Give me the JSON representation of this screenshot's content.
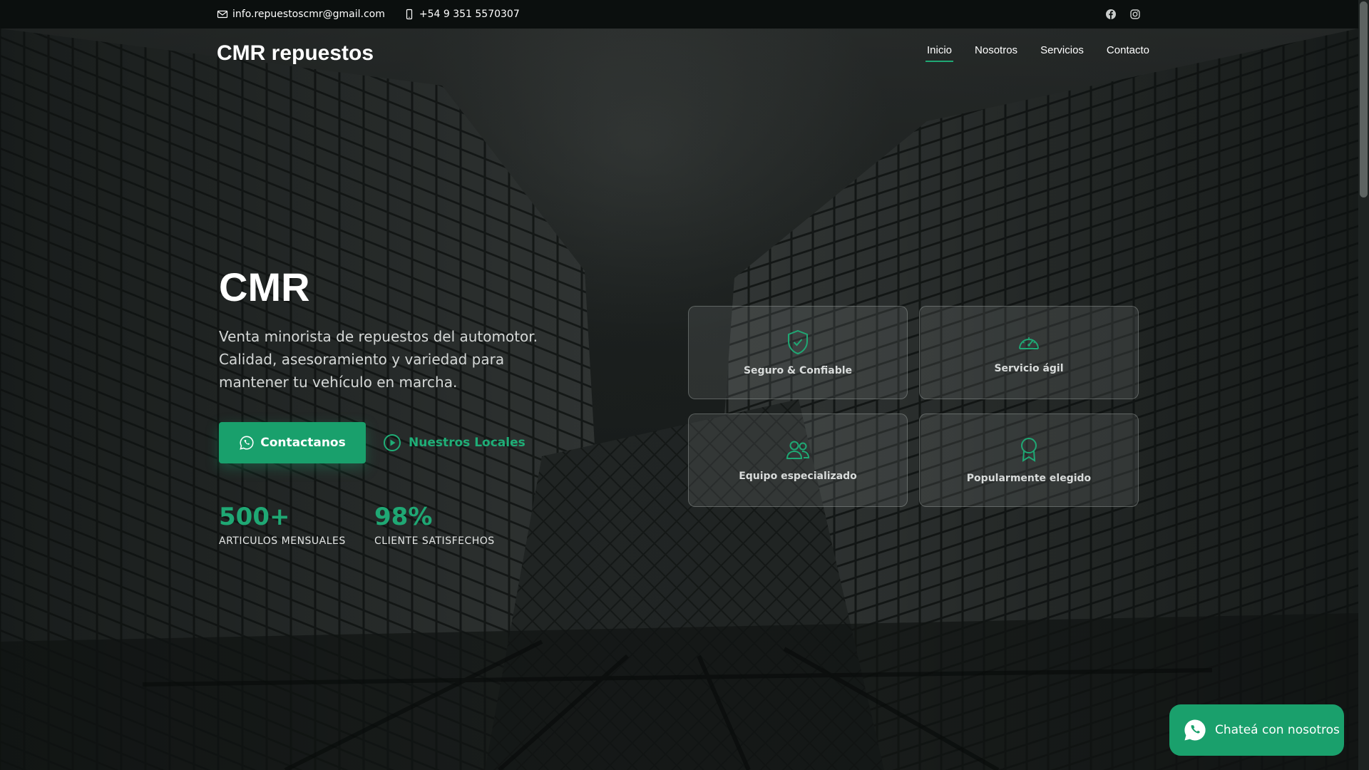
{
  "topbar": {
    "email": "info.repuestoscmr@gmail.com",
    "phone": "+54 9 351 5570307",
    "social": [
      "facebook-icon",
      "instagram-icon"
    ]
  },
  "header": {
    "brand": "CMR repuestos",
    "nav": [
      {
        "label": "Inicio",
        "active": true
      },
      {
        "label": "Nosotros",
        "active": false
      },
      {
        "label": "Servicios",
        "active": false
      },
      {
        "label": "Contacto",
        "active": false
      }
    ]
  },
  "hero": {
    "title": "CMR",
    "description": "Venta minorista de repuestos del automotor. Calidad, asesoramiento y variedad para mantener tu vehículo en marcha.",
    "primary_button": "Contactanos",
    "secondary_link": "Nuestros Locales",
    "stats": [
      {
        "value": "500+",
        "label": "ARTICULOS MENSUALES"
      },
      {
        "value": "98%",
        "label": "CLIENTE SATISFECHOS"
      }
    ]
  },
  "features": [
    {
      "label": "Seguro & Confiable",
      "icon": "shield-check-icon"
    },
    {
      "label": "Servicio ágil",
      "icon": "speedometer-icon"
    },
    {
      "label": "Equipo especializado",
      "icon": "people-icon"
    },
    {
      "label": "Popularmente elegido",
      "icon": "award-icon"
    }
  ],
  "whatsapp": {
    "label": "Chateá con nosotros"
  },
  "colors": {
    "accent": "#19a06c",
    "topbar": "#0b0f0e"
  }
}
